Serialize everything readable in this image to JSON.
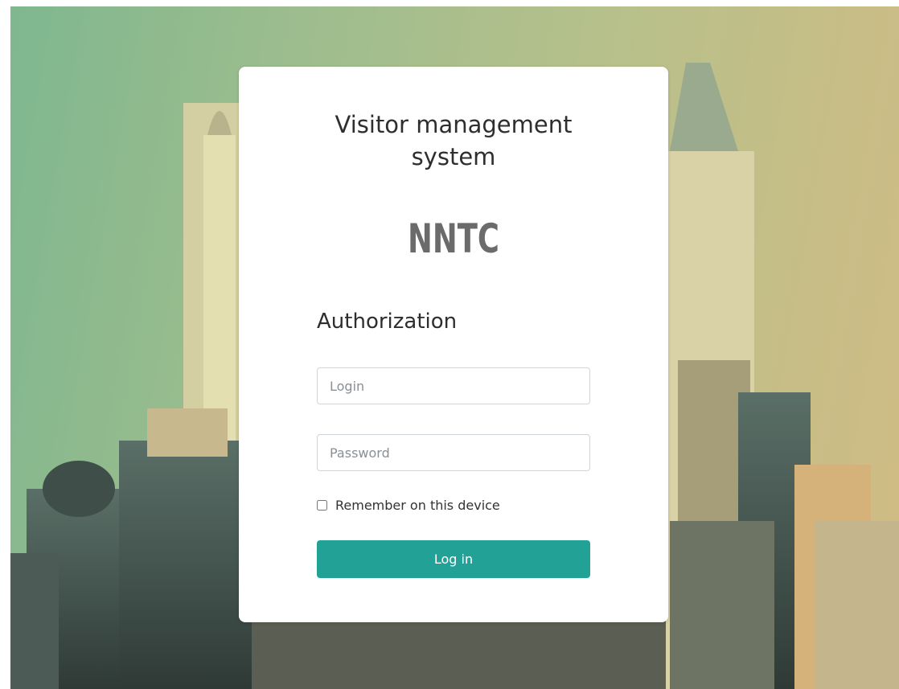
{
  "app": {
    "title": "Visitor management system",
    "logo_text": "NNTC"
  },
  "auth": {
    "heading": "Authorization",
    "login_placeholder": "Login",
    "password_placeholder": "Password",
    "remember_label": "Remember on this device",
    "remember_checked": false,
    "submit_label": "Log in"
  },
  "colors": {
    "accent": "#22a196",
    "logo": "#6b6b6b",
    "background_start": "#7fb78f",
    "background_end": "#d0bb84"
  }
}
